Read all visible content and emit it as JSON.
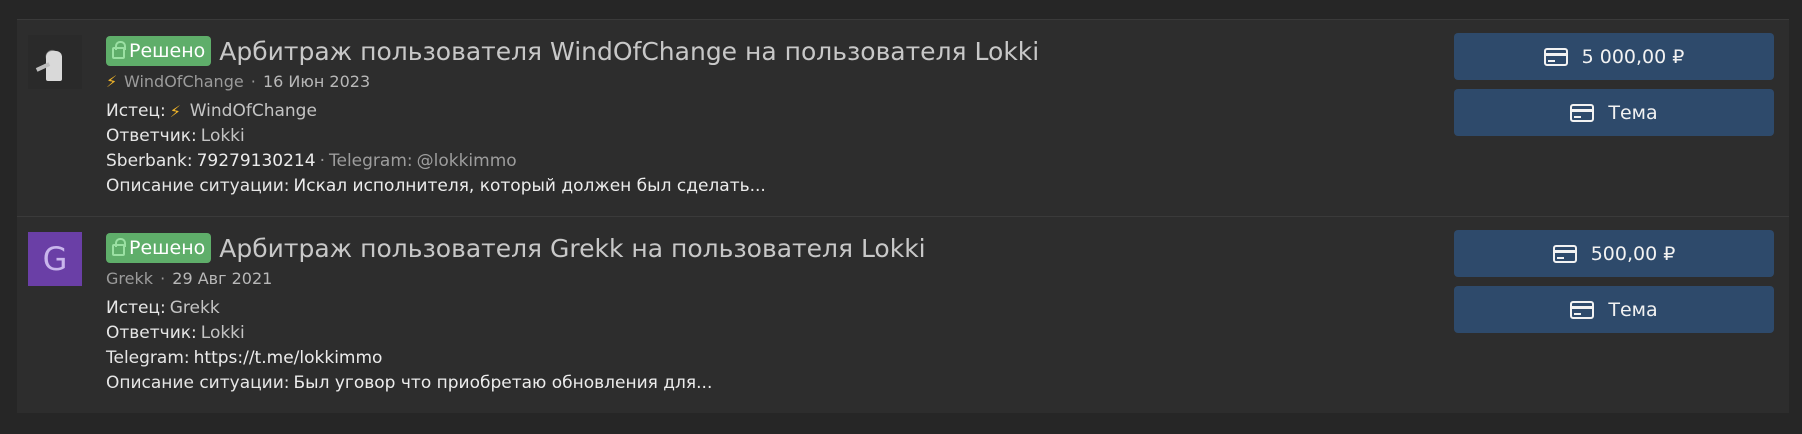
{
  "arbitrations": [
    {
      "badge": "Решено",
      "title": "Арбитраж пользователя WindOfChange на пользователя Lokki",
      "author": "WindOfChange",
      "date": "16 Июн 2023",
      "plaintiff_label": "Истец:",
      "plaintiff": "WindOfChange",
      "defendant_label": "Ответчик:",
      "defendant": "Lokki",
      "sberbank_label": "Sberbank:",
      "sberbank": "79279130214",
      "telegram_label": "Telegram:",
      "telegram": "@lokkimmo",
      "description_label": "Описание ситуации:",
      "description": "Искал исполнителя, который должен был сделать...",
      "amount": "5 000,00 ₽",
      "topic_label": "Тема"
    },
    {
      "badge": "Решено",
      "title": "Арбитраж пользователя Grekk на пользователя Lokki",
      "author": "Grekk",
      "avatar_letter": "G",
      "date": "29 Авг 2021",
      "plaintiff_label": "Истец:",
      "plaintiff": "Grekk",
      "defendant_label": "Ответчик:",
      "defendant": "Lokki",
      "telegram_label": "Telegram:",
      "telegram": "https://t.me/lokkimmo",
      "description_label": "Описание ситуации:",
      "description": "Был уговор что приобретаю обновления для...",
      "amount": "500,00 ₽",
      "topic_label": "Тема"
    }
  ],
  "colors": {
    "background": "#262626",
    "panel": "#2d2d2d",
    "badge_green": "#5fae6a",
    "button_blue": "#2e4a6b",
    "avatar_purple": "#6a3fa6",
    "bolt_yellow": "#f0b429"
  },
  "icons": {
    "badge": "lock-icon",
    "user_mark": "bolt-icon",
    "buttons": "credit-card-icon"
  }
}
